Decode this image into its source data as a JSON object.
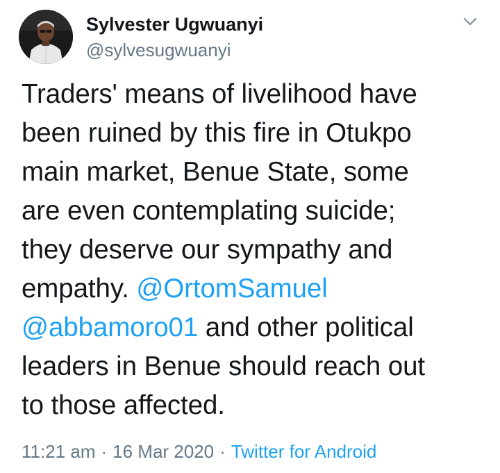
{
  "user": {
    "display_name": "Sylvester Ugwuanyi",
    "handle": "@sylvesugwuanyi"
  },
  "icons": {
    "menu": "chevron-down-icon",
    "avatar": "avatar"
  },
  "tweet": {
    "lines": [
      {
        "text": "Traders' means of livelihood have"
      },
      {
        "text": "been ruined by this fire in Otukpo"
      },
      {
        "text": "main market, Benue State, some"
      },
      {
        "text": "are even contemplating suicide;"
      },
      {
        "text": "they deserve our sympathy and"
      },
      {
        "pre": "empathy. ",
        "mention": "@OrtomSamuel"
      },
      {
        "mention": "@abbamoro01",
        "post": " and other political"
      },
      {
        "text": "leaders in Benue should reach out"
      },
      {
        "text": "to those affected."
      }
    ]
  },
  "meta": {
    "time": "11:21 am",
    "separator": "·",
    "date": "16 Mar 2020",
    "source": "Twitter for Android"
  },
  "colors": {
    "text": "#14171a",
    "secondary": "#657786",
    "link": "#1da1f2"
  }
}
